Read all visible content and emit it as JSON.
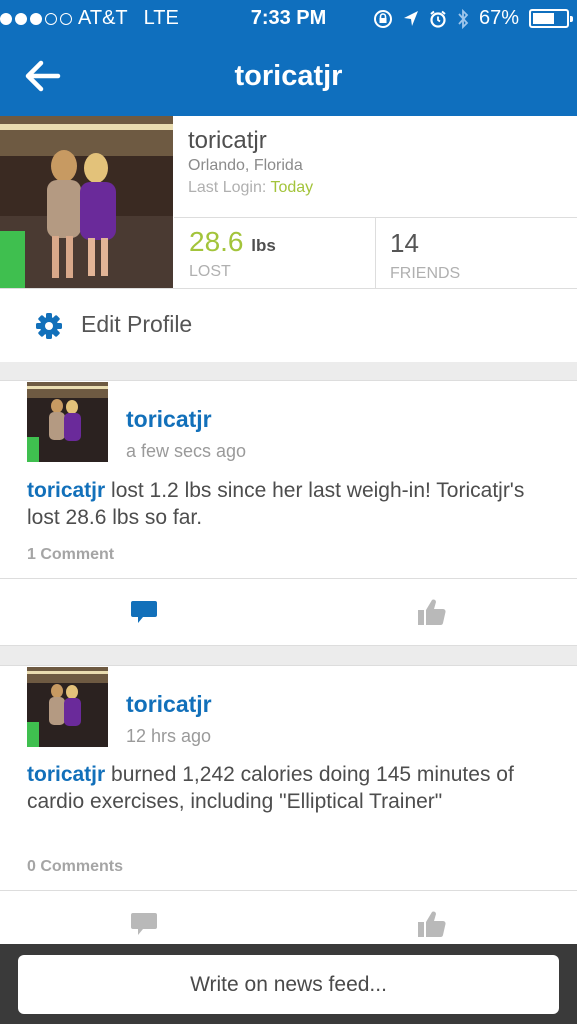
{
  "status_bar": {
    "carrier": "AT&T",
    "network": "LTE",
    "time": "7:33 PM",
    "battery": "67%",
    "battery_level": 0.67
  },
  "nav": {
    "title": "toricatjr",
    "back_icon": "arrow-left-icon"
  },
  "profile": {
    "username": "toricatjr",
    "location": "Orlando, Florida",
    "last_login_label": "Last Login: ",
    "last_login_value": "Today",
    "lost_value": "28.6",
    "lost_unit": "lbs",
    "lost_label": "LOST",
    "friends_value": "14",
    "friends_label": "FRIENDS",
    "edit_label": "Edit Profile"
  },
  "feed": [
    {
      "name": "toricatjr",
      "time": "a few secs ago",
      "body_user": "toricatjr",
      "body_text": " lost 1.2 lbs since her last weigh-in! Toricatjr's lost 28.6 lbs so far.",
      "comments": "1 Comment"
    },
    {
      "name": "toricatjr",
      "time": "12 hrs ago",
      "body_user": "toricatjr",
      "body_text": "  burned 1,242 calories doing 145 minutes of cardio exercises, including \"Elliptical Trainer\"",
      "comments": "0 Comments"
    }
  ],
  "write_bar": {
    "placeholder": "Write on news feed..."
  },
  "colors": {
    "brand_blue": "#0f6fbe",
    "link_blue": "#1270ba",
    "accent_green": "#a3c43b"
  }
}
